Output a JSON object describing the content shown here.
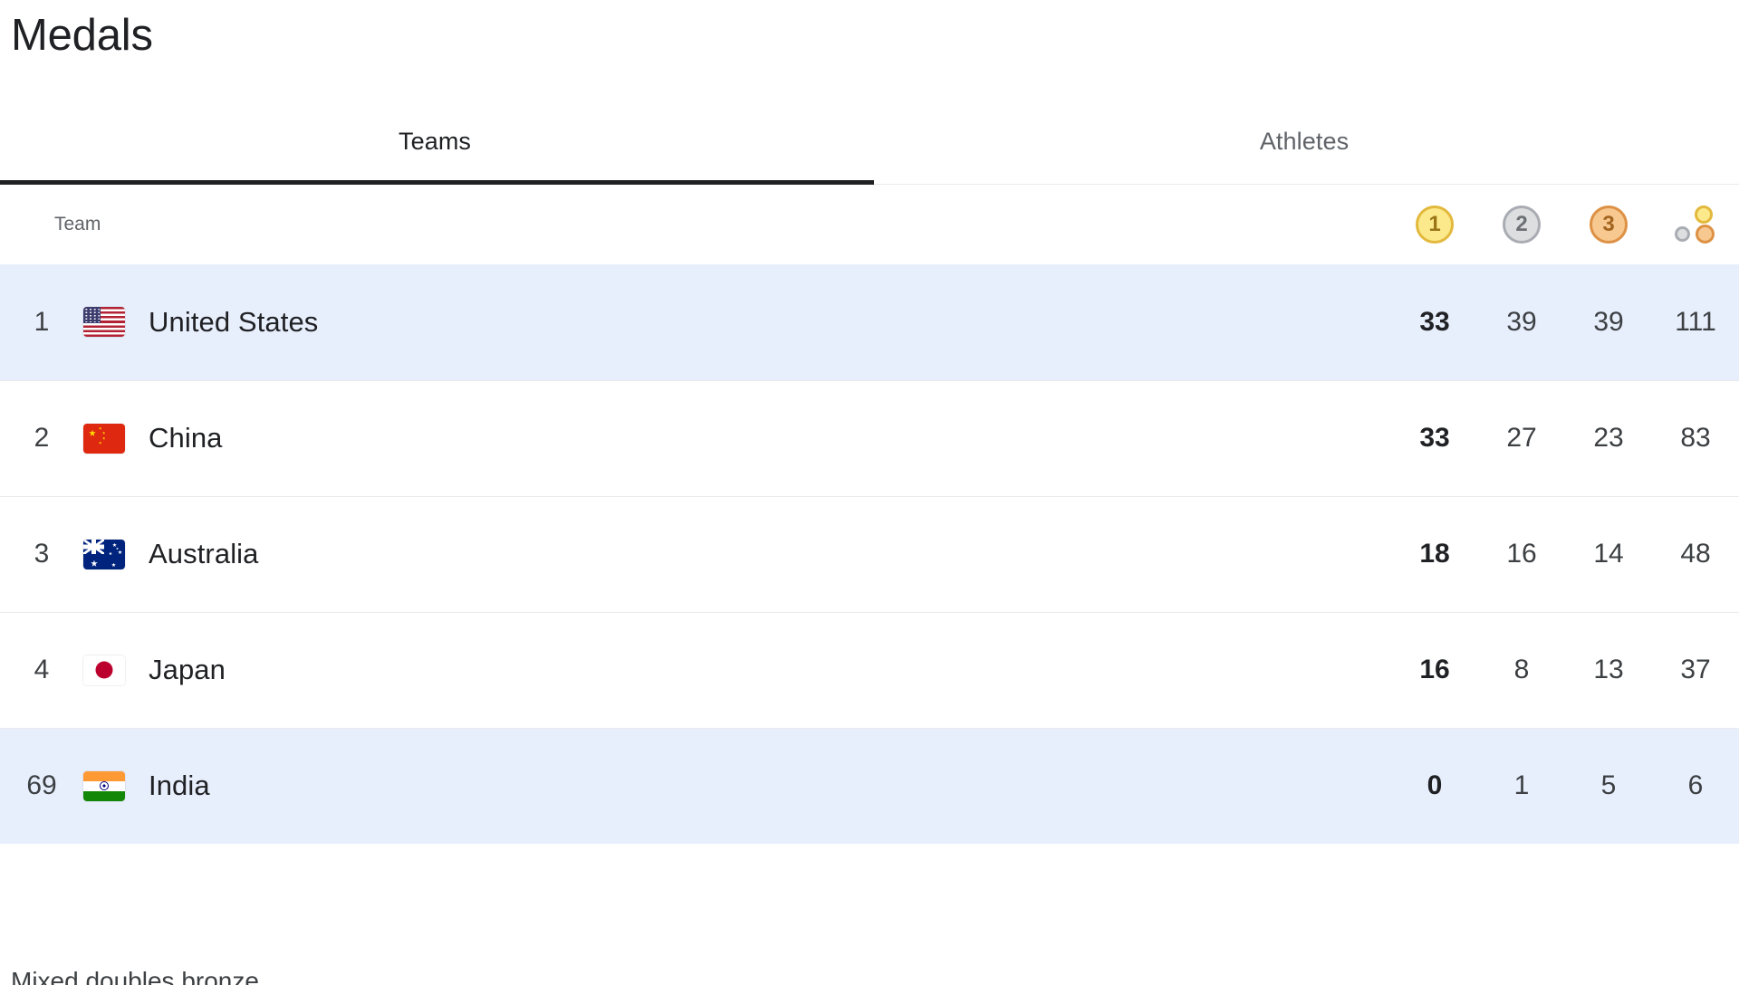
{
  "header": {
    "title": "Medals"
  },
  "tabs": [
    {
      "label": "Teams",
      "active": true
    },
    {
      "label": "Athletes",
      "active": false
    }
  ],
  "table": {
    "columns": {
      "team_label": "Team",
      "gold_icon": "gold-medal-icon",
      "gold_icon_text": "1",
      "silver_icon": "silver-medal-icon",
      "silver_icon_text": "2",
      "bronze_icon": "bronze-medal-icon",
      "bronze_icon_text": "3",
      "total_icon": "total-medals-icon"
    },
    "rows": [
      {
        "rank": "1",
        "flag": "flag-united-states",
        "team": "United States",
        "gold": "33",
        "silver": "39",
        "bronze": "39",
        "total": "111",
        "highlighted": true
      },
      {
        "rank": "2",
        "flag": "flag-china",
        "team": "China",
        "gold": "33",
        "silver": "27",
        "bronze": "23",
        "total": "83",
        "highlighted": false
      },
      {
        "rank": "3",
        "flag": "flag-australia",
        "team": "Australia",
        "gold": "18",
        "silver": "16",
        "bronze": "14",
        "total": "48",
        "highlighted": false
      },
      {
        "rank": "4",
        "flag": "flag-japan",
        "team": "Japan",
        "gold": "16",
        "silver": "8",
        "bronze": "13",
        "total": "37",
        "highlighted": false
      },
      {
        "rank": "69",
        "flag": "flag-india",
        "team": "India",
        "gold": "0",
        "silver": "1",
        "bronze": "5",
        "total": "6",
        "highlighted": true
      }
    ]
  },
  "footer": {
    "clipped_text": "Mixed doubles bronze"
  },
  "colors": {
    "highlight_row": "#e8effc",
    "gold": "#e3b93d",
    "silver": "#a9adb3",
    "bronze": "#dd9145",
    "active_tab_underline": "#202124",
    "row_divider": "#e8eaed",
    "text_primary": "#202124",
    "text_secondary": "#5f6368"
  }
}
